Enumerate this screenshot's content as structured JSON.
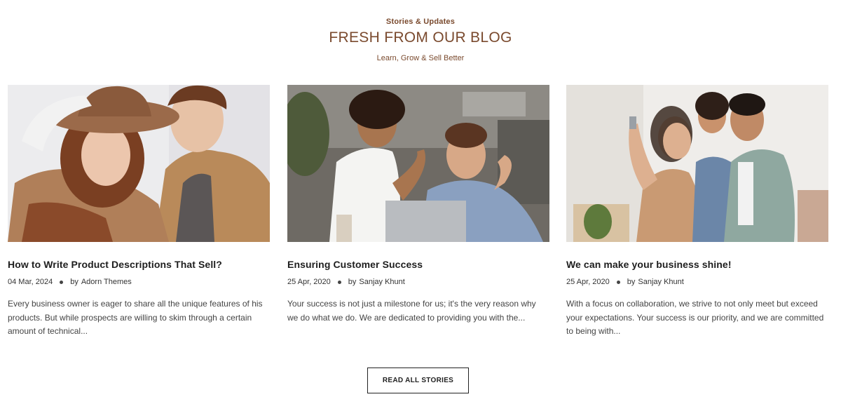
{
  "section": {
    "eyebrow": "Stories & Updates",
    "title": "FRESH FROM OUR BLOG",
    "subtitle": "Learn, Grow & Sell Better"
  },
  "posts": [
    {
      "title": "How to Write Product Descriptions That Sell?",
      "date": "04 Mar, 2024",
      "by_label": "by",
      "author": "Adorn Themes",
      "excerpt": "Every business owner is eager to share all the unique features of his products. But while prospects are willing to skim through a certain amount of technical...",
      "image": "fashion-couple-photo"
    },
    {
      "title": "Ensuring Customer Success",
      "date": "25 Apr, 2020",
      "by_label": "by",
      "author": "Sanjay Khunt",
      "excerpt": "Your success is not just a milestone for us; it's the very reason why we do what we do. We are dedicated to providing you with the...",
      "image": "celebrating-coworkers-photo"
    },
    {
      "title": "We can make your business shine!",
      "date": "25 Apr, 2020",
      "by_label": "by",
      "author": "Sanjay Khunt",
      "excerpt": "With a focus on collaboration, we strive to not only meet but exceed your expectations. Your success is our priority, and we are committed to being with...",
      "image": "family-with-keys-photo"
    }
  ],
  "cta": {
    "label": "READ ALL STORIES"
  },
  "colors": {
    "accent": "#7a4a2e",
    "text": "#1e1e1e",
    "border": "#222222"
  }
}
